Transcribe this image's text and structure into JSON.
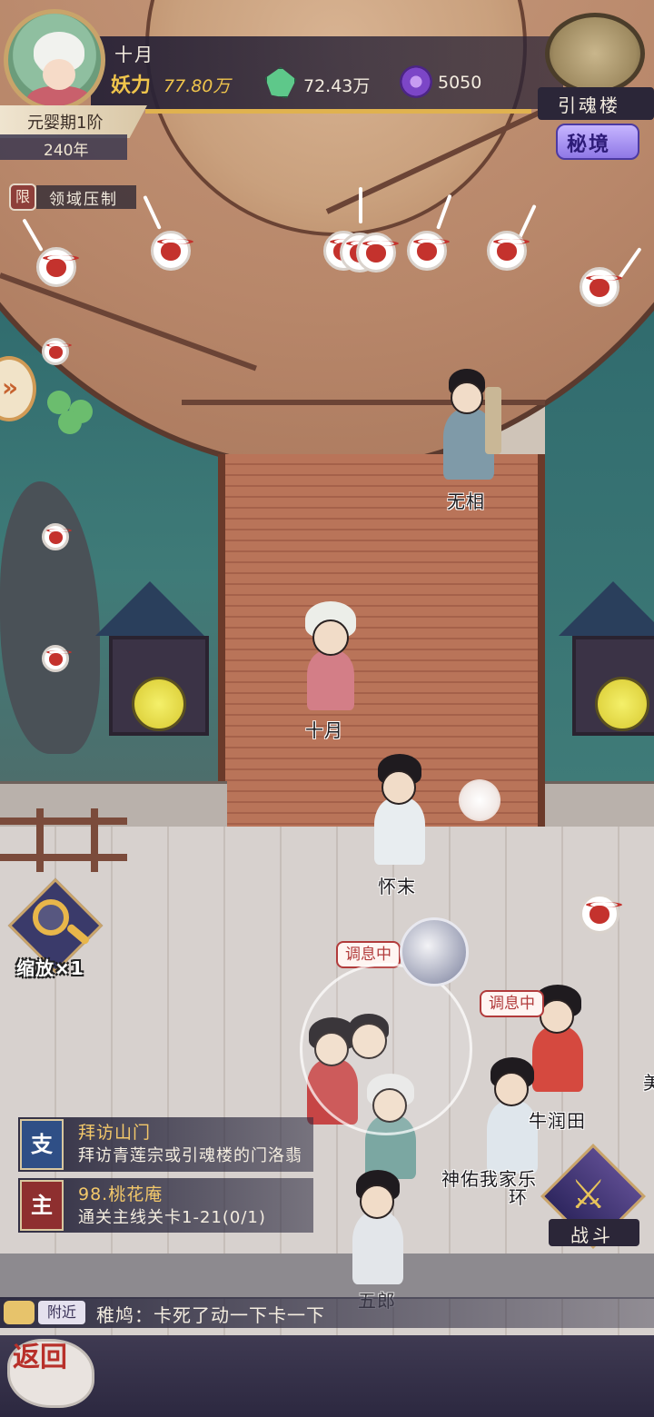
{
  "player": {
    "name": "十月",
    "power_label": "妖力",
    "power_value": "77.80万",
    "gem_value": "72.43万",
    "soul_value": "5050",
    "realm": "元婴期1阶",
    "age": "240年"
  },
  "map_button": {
    "label": "引魂楼",
    "badge": "秘境"
  },
  "domain": {
    "icon_char": "限",
    "label": "领域压制"
  },
  "side_arrow": "»",
  "zoom": {
    "label": "缩放×1"
  },
  "characters": {
    "wuxiang": "无相",
    "shiyue": "十月",
    "huaimo": "怀末",
    "niutian": "牛润田",
    "shenyou": "神佑我家乐",
    "huan": "环",
    "wulang": "五郎",
    "partial_right": "美"
  },
  "status_bubbles": {
    "resting_1": "调息中",
    "resting_2": "调息中"
  },
  "quests": [
    {
      "badge": "支",
      "title": "拜访山门",
      "desc": "拜访青莲宗或引魂楼的门洛翡"
    },
    {
      "badge": "主",
      "title": "98.桃花庵",
      "desc": "通关主线关卡1-21(0/1)"
    }
  ],
  "battle": {
    "label": "战斗",
    "icon": "⚔"
  },
  "chat": {
    "tab": "附近",
    "message": "稚鸠：卡死了动一下卡一下"
  },
  "back_button": {
    "label": "返回"
  },
  "colors": {
    "gold": "#f0c54c",
    "hud_dark": "#2b2638",
    "marker_red": "#c4322d",
    "quest_badge_branch": "#2f4f86",
    "quest_badge_main": "#8e2f2f"
  }
}
